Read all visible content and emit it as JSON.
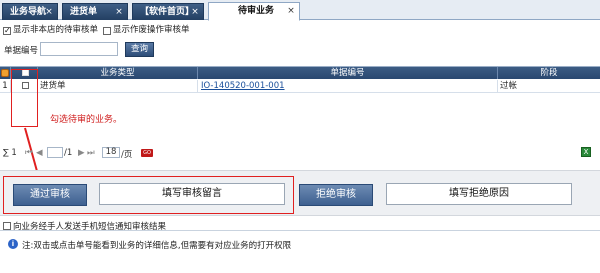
{
  "tabs": [
    {
      "label": "业务导航",
      "active": false
    },
    {
      "label": "进货单",
      "active": false
    },
    {
      "label": "【软件首页】",
      "active": false
    },
    {
      "label": "待审业务",
      "active": true
    }
  ],
  "tab_close_glyph": "×",
  "filters": {
    "show_non_store_pending": "显示非本店的待审核单",
    "show_voided_pending": "显示作废操作审核单"
  },
  "search": {
    "doc_no_label": "单据编号",
    "doc_no_value": "",
    "query_button": "查询"
  },
  "grid": {
    "columns": [
      "业务类型",
      "单据编号",
      "阶段"
    ],
    "rows": [
      {
        "index": "1",
        "type": "进货单",
        "doc_no": "IO-140520-001-001",
        "stage": "过帐"
      }
    ]
  },
  "annotation": "勾选待审的业务。",
  "pager": {
    "sum_label": "∑ 1",
    "nav_first": "⏮",
    "nav_prev": "◀",
    "current_page": "",
    "total_pages": "/1",
    "nav_next": "▶",
    "nav_last": "⏭",
    "page_size": "18",
    "per_page_label": "/页",
    "go_label": "GO"
  },
  "actions": {
    "approve": "通过审核",
    "comment": "填写审核留言",
    "reject": "拒绝审核",
    "reject_reason": "填写拒绝原因"
  },
  "sms_option": "向业务经手人发送手机短信通知审核结果",
  "note": "注:双击或点击单号能看到业务的详细信息,但需要有对应业务的打开权限",
  "colors": {
    "header_dark": "#2a4870",
    "accent_red": "#e02020",
    "link_blue": "#1a4f9a"
  }
}
